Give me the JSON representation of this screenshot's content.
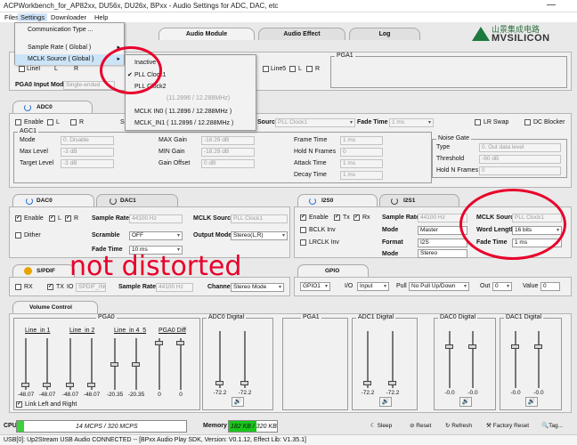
{
  "window": {
    "title": "ACPWorkbench_for_AP82xx, DU56x, DU26x, BPxx - Audio Settings for ADC, DAC, etc",
    "minimize": "—"
  },
  "menu": {
    "items": [
      "Files",
      "Settings",
      "Downloader",
      "Help"
    ]
  },
  "logo": {
    "cn": "山景集成电路",
    "en": "MVSILICON"
  },
  "main_tabs": [
    "Audio Module",
    "Audio Effect",
    "Log"
  ],
  "settings_menu": {
    "items": [
      "Communication Type ...",
      "Sample Rate ( Global )",
      "MCLK Source ( Global )"
    ],
    "submenu_arrow": "▸"
  },
  "mclk_submenu": {
    "items": [
      "Inactive",
      "PLL Clock1",
      "PLL Clock2",
      "(11.2896 / 12.288MHz)",
      "MCLK IN0  ( 11.2896 / 12.288MHz )",
      "MCLK_IN1  ( 11.2896 / 12.288MHz )"
    ],
    "checked": "✔"
  },
  "line_in": {
    "chk1": "LineI",
    "l": "L",
    "r": "R",
    "chk5": "Line5",
    "pga0_title": "PGA1",
    "pga0_mode_label": "PGA0 Input Mode",
    "pga0_mode_value": "Single-ended"
  },
  "adc0": {
    "tab": "ADC0",
    "enable": "Enable",
    "l": "L",
    "r": "R",
    "s": "S",
    "mclk_label": "Source",
    "mclk_value": "PLL Clock1",
    "fade_label": "Fade Time",
    "fade_value": "1 ms",
    "lr_swap": "LR Swap",
    "dc_blocker": "DC Blocker",
    "agc_title": "AGC1",
    "agc_left": [
      {
        "label": "Mode",
        "value": "0. Disable"
      },
      {
        "label": "Max Level",
        "value": "-3 dB"
      },
      {
        "label": "Target Level",
        "value": "-3 dB"
      }
    ],
    "agc_mid": [
      {
        "label": "MAX Gain",
        "value": "-18.29 dB"
      },
      {
        "label": "MIN Gain",
        "value": "-18.29 dB"
      },
      {
        "label": "Gain Offset",
        "value": "0 dB"
      }
    ],
    "agc_right": [
      {
        "label": "Frame Time",
        "value": "1 ms"
      },
      {
        "label": "Hold N Frames",
        "value": "0"
      },
      {
        "label": "Attack Time",
        "value": "1 ms"
      },
      {
        "label": "Decay Time",
        "value": "1 ms"
      }
    ],
    "noise_gate_title": "Noise Gate",
    "noise_gate": [
      {
        "label": "Type",
        "value": "0. Out data level"
      },
      {
        "label": "Threshold",
        "value": "-90 dB"
      },
      {
        "label": "Hold N Frames",
        "value": "0"
      }
    ]
  },
  "dac": {
    "tab0": "DAC0",
    "tab1": "DAC1",
    "enable": "Enable",
    "l": "L",
    "r": "R",
    "dither": "Dither",
    "sample_rate_label": "Sample Rate",
    "sample_rate_value": "44100 Hz",
    "mclk_label": "MCLK Source",
    "mclk_value": "PLL Clock1",
    "scramble_label": "Scramble",
    "scramble_value": "OFF",
    "output_label": "Output Mode",
    "output_value": "Stereo(L,R)",
    "fade_label": "Fade Time",
    "fade_value": "10 ms"
  },
  "i2s": {
    "tab0": "I2S0",
    "tab1": "I2S1",
    "enable": "Enable",
    "tx": "Tx",
    "rx": "Rx",
    "bclk": "BCLK Inv",
    "lrclk": "LRCLK Inv",
    "sample_rate_label": "Sample Rate",
    "sample_rate_value": "44100 Hz",
    "mode_label": "Mode",
    "mode_value": "Master",
    "format_label": "Format",
    "format_value": "I2S",
    "mode2_label": "Mode",
    "mode2_value": "Stereo",
    "mclk_label": "MCLK Source",
    "mclk_value": "PLL Clock1",
    "wordlen_label": "Word Length",
    "wordlen_value": "16 bits",
    "fade_label": "Fade Time",
    "fade_value": "1 ms"
  },
  "spdif": {
    "tab": "S/PDIF",
    "rx": "RX",
    "tx": "TX",
    "io_label": "IO",
    "io_value": "SPDIF_IN0",
    "sample_rate_label": "Sample Rate",
    "sample_rate_value": "44100 Hz",
    "channel_label": "Channel",
    "channel_value": "Stereo Mode"
  },
  "gpio": {
    "tab": "GPIO",
    "port_value": "GPIO1",
    "io_label": "I/O",
    "io_value": "Input",
    "pull_label": "Pull",
    "pull_value": "No Pull Up/Down",
    "out_label": "Out",
    "out_value": "0",
    "value_label": "Value",
    "value_value": "0"
  },
  "volume": {
    "tab": "Volume Control",
    "pga0_title": "PGA0",
    "pga0_labels": [
      "Line_in 1",
      "Line_in 2",
      "Line_in 4_5",
      "PGA0 Diff"
    ],
    "pga0_values": [
      "-48.07",
      "-48.07",
      "-48.07",
      "-48.07",
      "-20.35",
      "-20.35",
      "0",
      "0"
    ],
    "pga0_levels": [
      0.05,
      0.05,
      0.05,
      0.05,
      0.5,
      0.5,
      0.95,
      0.95
    ],
    "adc0_title": "ADC0 Digital",
    "adc0_values": [
      "-72.2",
      "-72.2"
    ],
    "adc0_levels": [
      0.05,
      0.05
    ],
    "pga1_title": "PGA1",
    "adc1_title": "ADC1 Digital",
    "adc1_values": [
      "-72.2",
      "-72.2"
    ],
    "adc1_levels": [
      0.05,
      0.05
    ],
    "dac0_title": "DAC0 Digital",
    "dac0_values": [
      "-0.0",
      "-0.0"
    ],
    "dac0_levels": [
      0.75,
      0.75
    ],
    "dac1_title": "DAC1 Digital",
    "dac1_values": [
      "-0.0",
      "-0.0"
    ],
    "dac1_levels": [
      0.75,
      0.75
    ],
    "link": "Link Left and Right",
    "speaker": "🔊"
  },
  "bottom": {
    "cpu_label": "CPU",
    "cpu_value": "14 MCPS / 320 MCPS",
    "cpu_fraction": 0.04,
    "memory_label": "Memory",
    "memory_value": "182 KB / 320 KB",
    "memory_fraction": 0.57,
    "sleep": "Sleep",
    "reset": "Reset",
    "refresh": "Refresh",
    "factory": "Factory Reset",
    "tag": "Tag..."
  },
  "status": {
    "text": "USB[0]: Up2Stream USB Audio CONNECTED -- [BPxx Audio Play SDK,  Version: V0.1.12,  Effect Lib: V1.35.1]"
  },
  "annotation": {
    "text": "not distorted"
  },
  "colors": {
    "accent_red": "#e8002a",
    "cpu_bar": "#3bd23b",
    "memory_bar": "#19c519",
    "power_blue": "#2b6fd6"
  }
}
